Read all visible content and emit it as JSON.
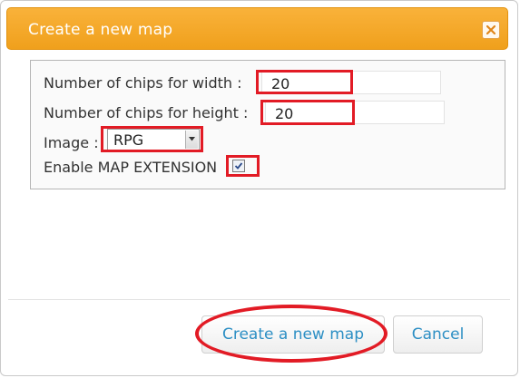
{
  "dialog": {
    "title": "Create a new map",
    "close_icon": "close-x-icon"
  },
  "form": {
    "width_label": "Number of chips for width :",
    "width_value": "20",
    "height_label": "Number of chips for height :",
    "height_value": "20",
    "image_label": "Image :",
    "image_selected": "RPG",
    "extension_label": "Enable MAP EXTENSION",
    "extension_checked": true
  },
  "footer": {
    "create_label": "Create a new map",
    "cancel_label": "Cancel"
  },
  "colors": {
    "titlebar": "#f0a01c",
    "highlight": "#e21b25",
    "button_text": "#2d8fc4"
  }
}
